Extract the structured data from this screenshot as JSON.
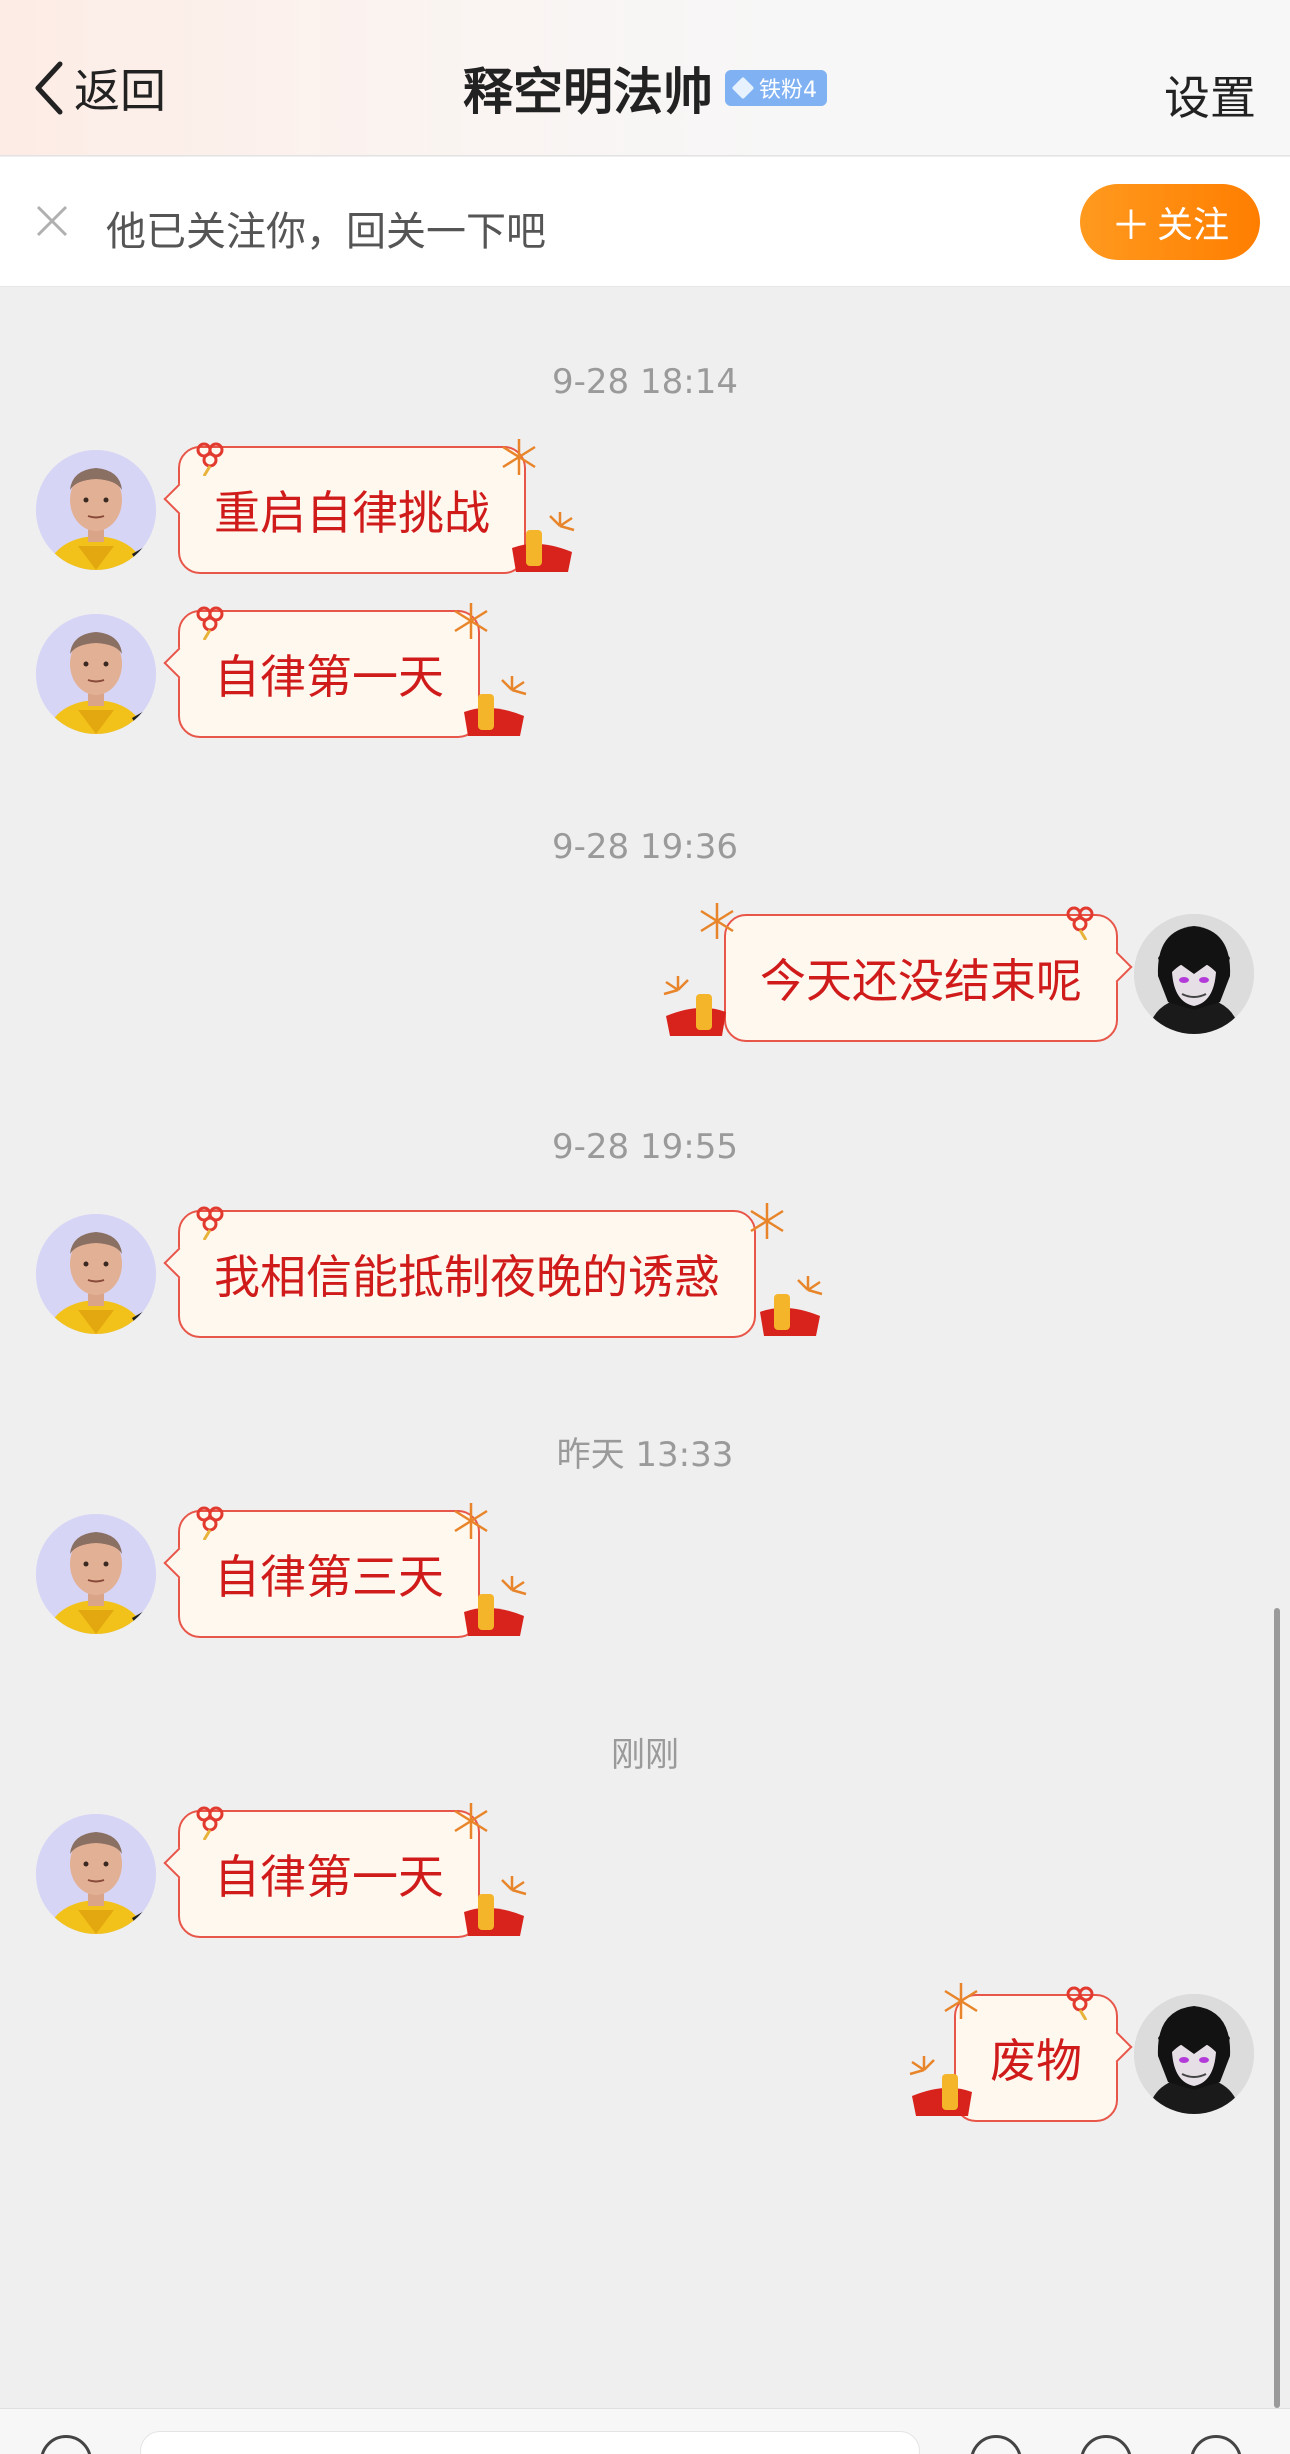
{
  "header": {
    "back_label": "返回",
    "title": "释空明法帅",
    "badge": "铁粉4",
    "settings_label": "设置"
  },
  "follow_bar": {
    "text": "他已关注你，回关一下吧",
    "button_label": "关注"
  },
  "messages": [
    {
      "timestamp": "9-28 18:14"
    },
    {
      "from": "other",
      "text": "重启自律挑战"
    },
    {
      "from": "other",
      "text": "自律第一天"
    },
    {
      "timestamp": "9-28 19:36"
    },
    {
      "from": "me",
      "text": "今天还没结束呢"
    },
    {
      "timestamp": "9-28 19:55"
    },
    {
      "from": "other",
      "text": "我相信能抵制夜晚的诱惑"
    },
    {
      "timestamp": "昨天 13:33"
    },
    {
      "from": "other",
      "text": "自律第三天"
    },
    {
      "timestamp": "刚刚"
    },
    {
      "from": "other",
      "text": "自律第一天"
    },
    {
      "from": "me",
      "text": "废物"
    }
  ],
  "colors": {
    "bubble_text": "#d01b1b",
    "bubble_border": "#e8564a",
    "bubble_fill": "#fff8ef",
    "follow_button": "#ff8a00",
    "badge": "#7fb1f3"
  }
}
